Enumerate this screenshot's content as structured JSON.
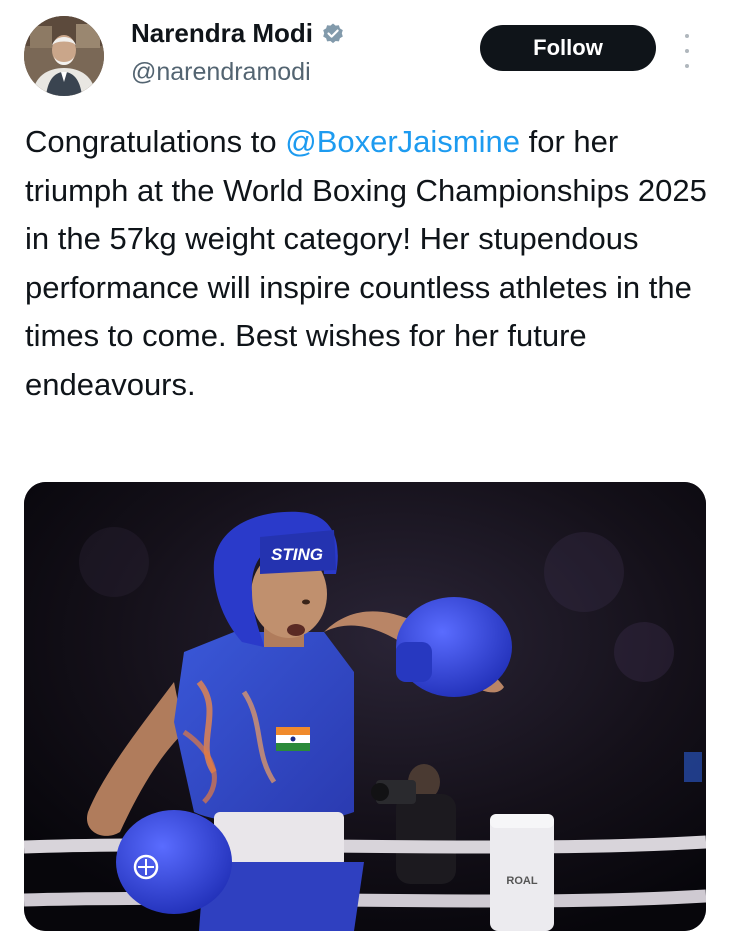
{
  "author": {
    "name": "Narendra Modi",
    "handle": "@narendramodi",
    "verified_badge": "verified-check-icon",
    "verified_color": "#829aab"
  },
  "follow_button": {
    "label": "Follow"
  },
  "more_menu": {
    "icon": "more-vertical-icon"
  },
  "tweet": {
    "before_mention": "Congratulations to ",
    "mention": "@BoxerJaismine",
    "after_mention": " for her triumph at the World Boxing Championships 2025 in the 57kg weight category! Her stupendous performance will inspire countless athletes in the times to come. Best wishes for her future endeavours."
  },
  "media": {
    "headgear_text": "STING",
    "post_text": "ROAL",
    "colors": {
      "singlet": "#2e48c4",
      "glove": "#3040d6",
      "mention": "#1d9bf0",
      "button_bg": "#0f1419"
    }
  }
}
